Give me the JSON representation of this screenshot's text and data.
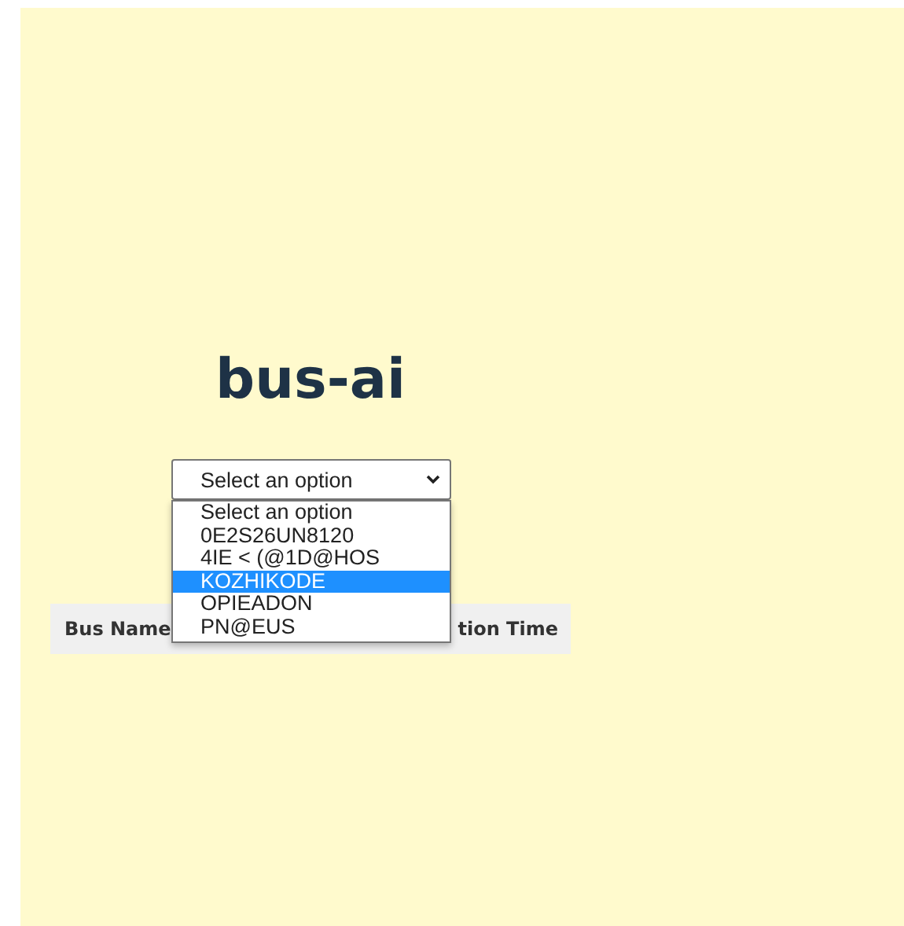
{
  "title": "bus-ai",
  "select": {
    "value": "Select an option",
    "expanded": true,
    "options": [
      {
        "label": "Select an option",
        "highlighted": false
      },
      {
        "label": "0E2S26UN8120",
        "highlighted": false
      },
      {
        "label": "4IE < (@1D@HOS",
        "highlighted": false
      },
      {
        "label": "KOZHIKODE",
        "highlighted": true
      },
      {
        "label": "OPIEADON",
        "highlighted": false
      },
      {
        "label": "PN@EUS",
        "highlighted": false
      }
    ]
  },
  "table": {
    "columns": [
      "Bus Name",
      "tion Time"
    ]
  }
}
